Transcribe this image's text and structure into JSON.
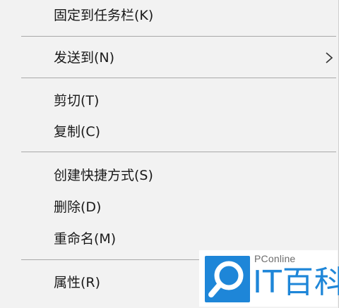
{
  "menu": {
    "items": [
      {
        "label": "固定到任务栏(K)"
      },
      {
        "label": "发送到(N)",
        "has_submenu": true
      },
      {
        "label": "剪切(T)"
      },
      {
        "label": "复制(C)"
      },
      {
        "label": "创建快捷方式(S)"
      },
      {
        "label": "删除(D)"
      },
      {
        "label": "重命名(M)"
      },
      {
        "label": "属性(R)"
      }
    ]
  },
  "watermark": {
    "site": "PConline",
    "title": "IT百科"
  },
  "colors": {
    "menu_bg": "#f2f2f2",
    "separator": "#a9a9a9",
    "text": "#1a1a1a",
    "brand_blue": "#1e86d8"
  }
}
